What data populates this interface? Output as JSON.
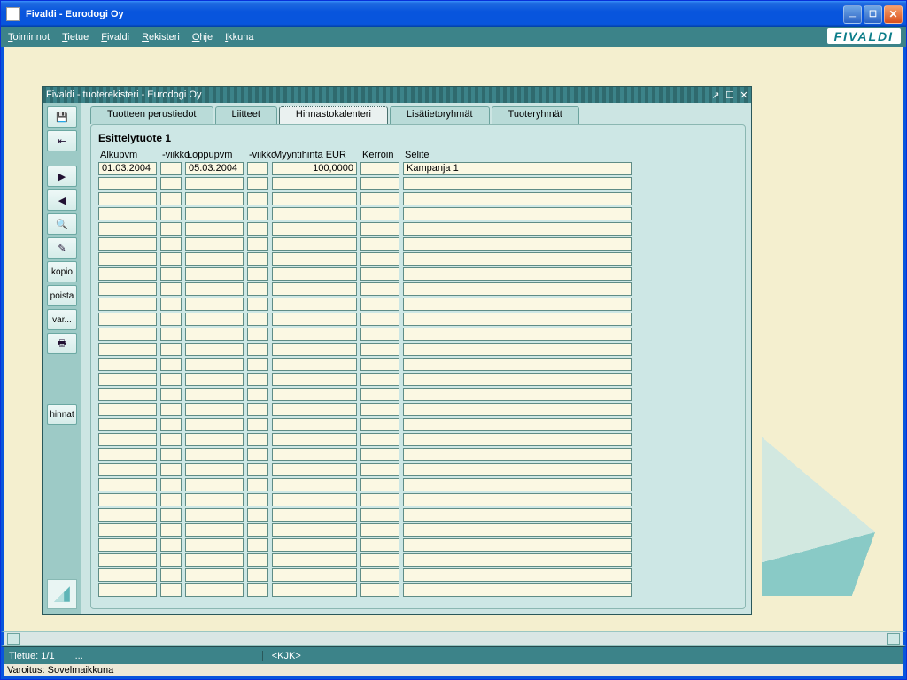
{
  "window": {
    "title": "Fivaldi - Eurodogi Oy"
  },
  "menubar": {
    "items": [
      "Toiminnot",
      "Tietue",
      "Fivaldi",
      "Rekisteri",
      "Ohje",
      "Ikkuna"
    ],
    "brand": "FIVALDI"
  },
  "subwindow": {
    "title": "Fivaldi - tuoterekisteri - Eurodogi Oy"
  },
  "tabs": [
    {
      "label": "Tuotteen perustiedot",
      "active": false
    },
    {
      "label": "Liitteet",
      "active": false
    },
    {
      "label": "Hinnastokalenteri",
      "active": true
    },
    {
      "label": "Lisätietoryhmät",
      "active": false
    },
    {
      "label": "Tuoteryhmät",
      "active": false
    }
  ],
  "panel": {
    "title": "Esittelytuote 1",
    "headers": {
      "alkupvm": "Alkupvm",
      "viikko1": "-viikko",
      "loppupvm": "Loppupvm",
      "viikko2": "-viikko",
      "myyntihinta": "Myyntihinta   EUR",
      "kerroin": "Kerroin",
      "selite": "Selite"
    },
    "rows": [
      {
        "alkupvm": "01.03.2004",
        "viikko1": "",
        "loppupvm": "05.03.2004",
        "viikko2": "",
        "myyntihinta": "100,0000",
        "kerroin": "",
        "selite": "Kampanja 1"
      }
    ],
    "empty_row_count": 28
  },
  "sidebar": {
    "save": "💾",
    "open": "⇤",
    "next": "▶",
    "prev": "◀",
    "search": "🔍",
    "new": "✎",
    "kopio": "kopio",
    "poista": "poista",
    "var": "var...",
    "print": "🖶",
    "hinnat": "hinnat"
  },
  "statusbar": {
    "record": "Tietue: 1/1",
    "mid": "...",
    "user": "<KJK>"
  },
  "warning": "Varoitus: Sovelmaikkuna"
}
